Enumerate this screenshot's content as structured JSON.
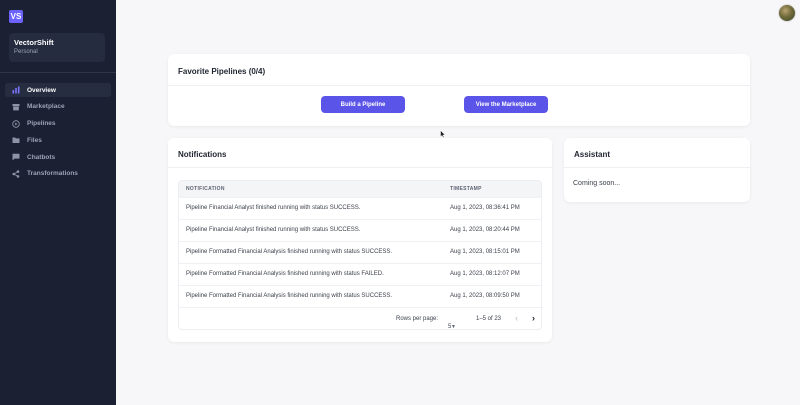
{
  "sidebar": {
    "logo": "VS",
    "workspace": {
      "name": "VectorShift",
      "type": "Personal"
    },
    "items": [
      {
        "label": "Overview",
        "icon": "bar-chart-icon",
        "active": true
      },
      {
        "label": "Marketplace",
        "icon": "store-icon",
        "active": false
      },
      {
        "label": "Pipelines",
        "icon": "play-circle-icon",
        "active": false
      },
      {
        "label": "Files",
        "icon": "folder-icon",
        "active": false
      },
      {
        "label": "Chatbots",
        "icon": "chat-icon",
        "active": false
      },
      {
        "label": "Transformations",
        "icon": "share-icon",
        "active": false
      }
    ]
  },
  "favorites": {
    "title": "Favorite Pipelines (0/4)",
    "build_label": "Build a Pipeline",
    "marketplace_label": "View the Marketplace"
  },
  "notifications": {
    "title": "Notifications",
    "columns": [
      "NOTIFICATION",
      "TIMESTAMP"
    ],
    "rows": [
      [
        "Pipeline Financial Analyst finished running with status SUCCESS.",
        "Aug 1, 2023, 08:36:41 PM"
      ],
      [
        "Pipeline Financial Analyst finished running with status SUCCESS.",
        "Aug 1, 2023, 08:20:44 PM"
      ],
      [
        "Pipeline Formatted Financial Analysis finished running with status SUCCESS.",
        "Aug 1, 2023, 08:15:01 PM"
      ],
      [
        "Pipeline Formatted Financial Analysis finished running with status FAILED.",
        "Aug 1, 2023, 08:12:07 PM"
      ],
      [
        "Pipeline Formatted Financial Analysis finished running with status SUCCESS.",
        "Aug 1, 2023, 08:09:50 PM"
      ]
    ],
    "pagination": {
      "rows_per_page_label": "Rows per page:",
      "rows_per_page": "5",
      "range": "1–5 of 23"
    }
  },
  "assistant": {
    "title": "Assistant",
    "text": "Coming soon..."
  },
  "colors": {
    "sidebar_bg": "#1b2132",
    "accent": "#5b54e8",
    "page_bg": "#f7f7f9"
  }
}
